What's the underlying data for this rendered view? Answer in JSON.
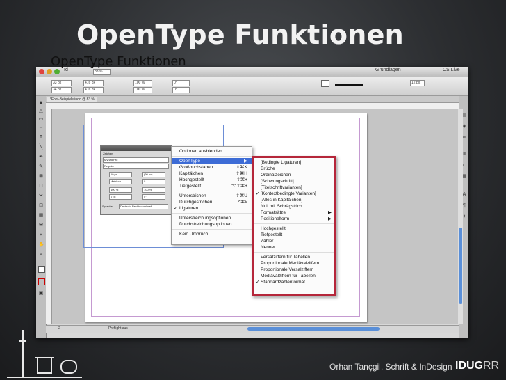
{
  "slide_title": "OpenType Funktionen",
  "app": {
    "zoom": "83 %",
    "workspace": "Grundlagen",
    "cs_live": "CS Live",
    "doc_tab": "*Font-Beispiele.indd @ 83 %",
    "x_field": "33 px",
    "y_field": "34 px",
    "w_field": "416 px",
    "h_field": "416 px",
    "scale_x": "100 %",
    "scale_y": "100 %",
    "rotation": "0°",
    "shear": "0°",
    "stroke_field": "12 px",
    "preflight_page": "2",
    "preflight_label": "Preflight aus",
    "ruler_marks": [
      "100",
      "50",
      "0",
      "50",
      "100",
      "150",
      "200",
      "250",
      "300",
      "350",
      "400",
      "450",
      "500",
      "550",
      "600",
      "650",
      "700"
    ]
  },
  "document": {
    "heading": "OpenType Funktionen"
  },
  "character_panel": {
    "title": " Zeichen",
    "font_family": "Myriad Pro",
    "font_style": "Regular",
    "size": "10 px",
    "leading": "(60 px)",
    "kerning": "Metrisch",
    "tracking": "0",
    "vscale": "100 %",
    "hscale": "100 %",
    "baseline": "0 px",
    "skew": "0°",
    "language_label": "Sprache:",
    "language_value": "Deutsch: Rechtschreibref..."
  },
  "flyout_menu": {
    "items": [
      {
        "label": "Optionen ausblenden",
        "shortcut": "",
        "check": "",
        "highlight": false
      },
      {
        "sep": true
      },
      {
        "label": "OpenType",
        "shortcut": "▶",
        "check": "",
        "highlight": true
      },
      {
        "label": "Großbuchstaben",
        "shortcut": "⇧⌘K",
        "check": "",
        "highlight": false
      },
      {
        "label": "Kapitälchen",
        "shortcut": "⇧⌘H",
        "check": "",
        "highlight": false
      },
      {
        "label": "Hochgestellt",
        "shortcut": "⇧⌘+",
        "check": "",
        "highlight": false
      },
      {
        "label": "Tiefgestellt",
        "shortcut": "⌥⇧⌘+",
        "check": "",
        "highlight": false
      },
      {
        "sep": true
      },
      {
        "label": "Unterstrichen",
        "shortcut": "⇧⌘U",
        "check": "",
        "highlight": false
      },
      {
        "label": "Durchgestrichen",
        "shortcut": "^⌘#",
        "check": "",
        "highlight": false
      },
      {
        "label": "Ligaturen",
        "shortcut": "",
        "check": "✓",
        "highlight": false
      },
      {
        "sep": true
      },
      {
        "label": "Unterstreichungsoptionen...",
        "shortcut": "",
        "check": "",
        "highlight": false
      },
      {
        "label": "Durchstreichungsoptionen...",
        "shortcut": "",
        "check": "",
        "highlight": false
      },
      {
        "sep": true
      },
      {
        "label": "Kein Umbruch",
        "shortcut": "",
        "check": "",
        "highlight": false
      }
    ]
  },
  "opentype_submenu": {
    "items": [
      {
        "label": "[Bedingte Ligaturen]",
        "check": "",
        "arrow": ""
      },
      {
        "label": "Brüche",
        "check": "",
        "arrow": ""
      },
      {
        "label": "Ordinalzeichen",
        "check": "",
        "arrow": ""
      },
      {
        "label": "[Schwungschrift]",
        "check": "",
        "arrow": ""
      },
      {
        "label": "[Titelschriftvarianten]",
        "check": "",
        "arrow": ""
      },
      {
        "label": "[Kontextbedingte Varianten]",
        "check": "✓",
        "arrow": ""
      },
      {
        "label": "[Alles in Kapitälchen]",
        "check": "",
        "arrow": ""
      },
      {
        "label": "Null mit Schrägstrich",
        "check": "",
        "arrow": ""
      },
      {
        "label": "Formatsätze",
        "check": "",
        "arrow": "▶"
      },
      {
        "label": "Positionalform",
        "check": "",
        "arrow": "▶"
      },
      {
        "sep": true
      },
      {
        "label": "Hochgestellt",
        "check": "",
        "arrow": ""
      },
      {
        "label": "Tiefgestellt",
        "check": "",
        "arrow": ""
      },
      {
        "label": "Zähler",
        "check": "",
        "arrow": ""
      },
      {
        "label": "Nenner",
        "check": "",
        "arrow": ""
      },
      {
        "sep": true
      },
      {
        "label": "Versalziffern für Tabellen",
        "check": "",
        "arrow": ""
      },
      {
        "label": "Proportionale Mediävalziffern",
        "check": "",
        "arrow": ""
      },
      {
        "label": "Proportionale Versalziffern",
        "check": "",
        "arrow": ""
      },
      {
        "label": "Mediävalziffern für Tabellen",
        "check": "",
        "arrow": ""
      },
      {
        "label": "Standardzahlenformat",
        "check": "✓",
        "arrow": ""
      }
    ]
  },
  "footer": {
    "author": "Orhan Tançgil, Schrift & InDesign",
    "logo_bold": "IDUG",
    "logo_rest": "RR"
  },
  "colors": {
    "highlight": "#3d6cd6",
    "submenu_border": "#b5263a"
  }
}
